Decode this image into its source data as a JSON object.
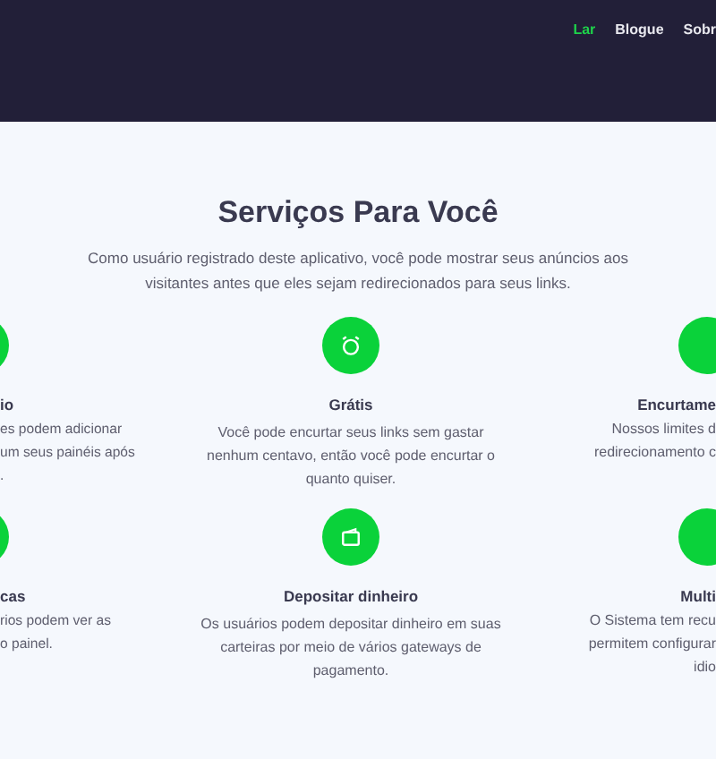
{
  "nav": [
    {
      "label": "Lar",
      "selected": true
    },
    {
      "label": "Blogue",
      "selected": false
    },
    {
      "label": "Sobr",
      "selected": false
    }
  ],
  "section": {
    "title": "Serviços Para Você",
    "subtitle": "Como usuário registrado deste aplicativo, você pode mostrar seus anúncios aos visitantes antes que eles sejam redirecionados para seus links."
  },
  "rows": [
    {
      "left": {
        "title": "io",
        "lines": [
          "es podem adicionar",
          "um seus painéis após",
          "."
        ]
      },
      "center": {
        "kind": "clock",
        "title": "Grátis",
        "description": "Você pode encurtar seus links sem gastar nenhum centavo, então você pode encurtar o quanto quiser."
      },
      "right": {
        "title": "Encurtame",
        "lines": [
          "Nossos limites d",
          "redirecionamento c"
        ]
      }
    },
    {
      "left": {
        "title": "cas",
        "lines": [
          "rios podem ver as",
          "o painel."
        ]
      },
      "center": {
        "kind": "wallet",
        "title": "Depositar dinheiro",
        "description": "Os usuários podem depositar dinheiro em suas carteiras por meio de vários gateways de pagamento."
      },
      "right": {
        "title": "Multi",
        "lines": [
          "O Sistema tem recu",
          "permitem configurar",
          "idio"
        ]
      }
    }
  ]
}
